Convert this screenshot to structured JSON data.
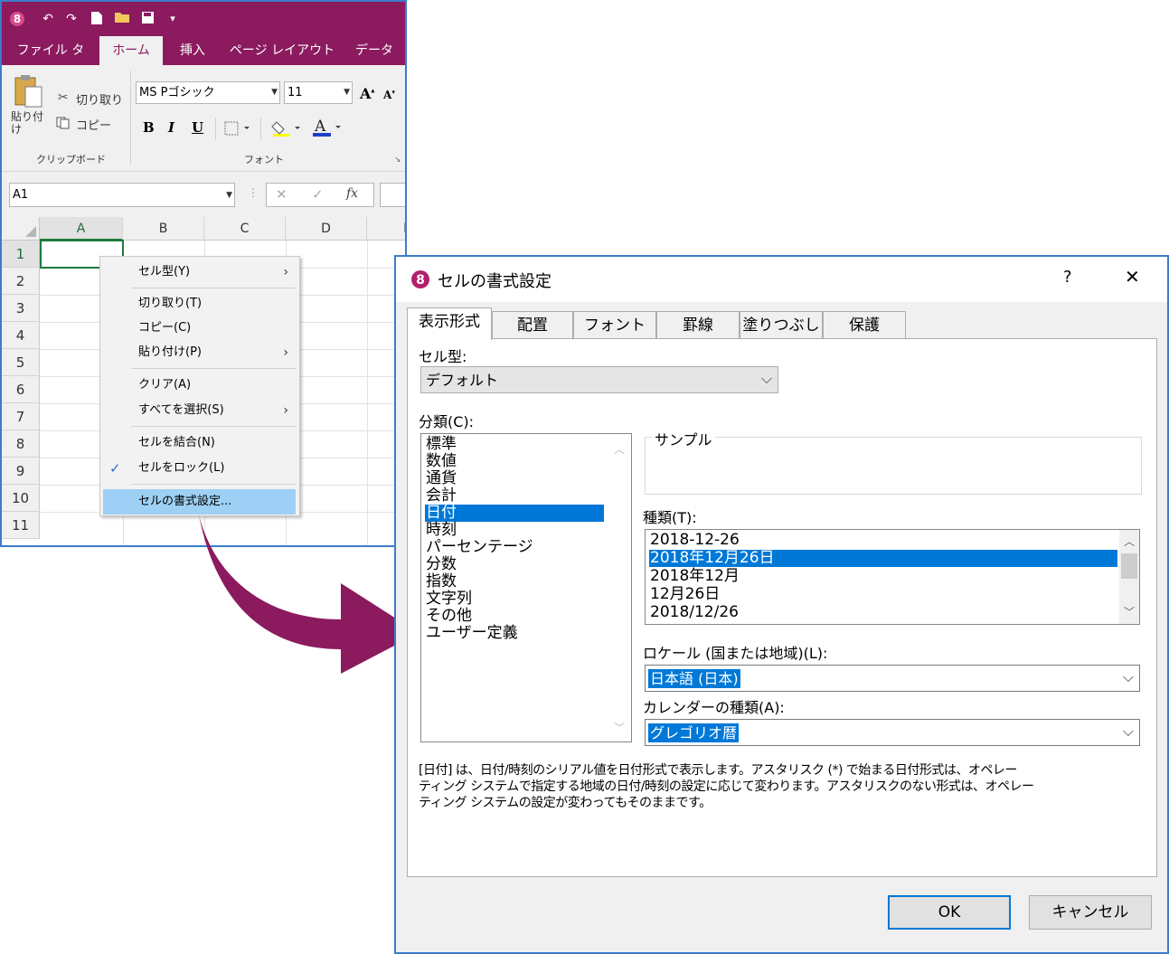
{
  "app": {
    "quick_access": [
      "↶",
      "↷",
      "🗋",
      "📂",
      "💾",
      "▾"
    ],
    "ribbon_tabs": [
      "ファイル タブ",
      "ホーム",
      "挿入",
      "ページ レイアウト",
      "データ"
    ],
    "active_tab": "ホーム",
    "clipboard": {
      "paste_label": "貼り付け",
      "cut_label": "切り取り",
      "copy_label": "コピー",
      "group_label": "クリップボード"
    },
    "font": {
      "name": "MS Pゴシック",
      "size": "11",
      "bold": "B",
      "italic": "I",
      "underline": "U",
      "group_label": "フォント"
    },
    "formula_bar": {
      "name_box": "A1",
      "cancel": "✕",
      "enter": "✓",
      "fx": "fx"
    },
    "columns": [
      "A",
      "B",
      "C",
      "D",
      "E"
    ],
    "rows": [
      "1",
      "2",
      "3",
      "4",
      "5",
      "6",
      "7",
      "8",
      "9",
      "10",
      "11"
    ]
  },
  "context_menu": {
    "items": [
      {
        "label": "セル型(Y)",
        "arrow": "›"
      },
      {
        "label": "切り取り(T)"
      },
      {
        "label": "コピー(C)"
      },
      {
        "label": "貼り付け(P)",
        "arrow": "›"
      },
      {
        "label": "クリア(A)"
      },
      {
        "label": "すべてを選択(S)",
        "arrow": "›"
      },
      {
        "label": "セルを結合(N)"
      },
      {
        "label": "セルをロック(L)",
        "check": "✓"
      },
      {
        "label": "セルの書式設定..."
      }
    ]
  },
  "dialog": {
    "title": "セルの書式設定",
    "help": "?",
    "close": "✕",
    "tabs": [
      "表示形式",
      "配置",
      "フォント",
      "罫線",
      "塗りつぶし",
      "保護"
    ],
    "active_tab": "表示形式",
    "cell_type_label": "セル型:",
    "cell_type_value": "デフォルト",
    "category_label": "分類(C):",
    "categories": [
      "標準",
      "数値",
      "通貨",
      "会計",
      "日付",
      "時刻",
      "パーセンテージ",
      "分数",
      "指数",
      "文字列",
      "その他",
      "ユーザー定義"
    ],
    "selected_category": "日付",
    "sample_label": "サンプル",
    "type_label": "種類(T):",
    "types": [
      "2018-12-26",
      "2018年12月26日",
      "2018年12月",
      "12月26日",
      "2018/12/26"
    ],
    "selected_type": "2018年12月26日",
    "locale_label": "ロケール (国または地域)(L):",
    "locale_value": "日本語 (日本)",
    "calendar_label": "カレンダーの種類(A):",
    "calendar_value": "グレゴリオ暦",
    "description_lines": [
      "[日付] は、日付/時刻のシリアル値を日付形式で表示します。アスタリスク (*) で始まる日付形式は、オペレー",
      "ティング システムで指定する地域の日付/時刻の設定に応じて変わります。アスタリスクのない形式は、オペレー",
      "ティング システムの設定が変わってもそのままです。"
    ],
    "ok_label": "OK",
    "cancel_label": "キャンセル"
  },
  "colors": {
    "brand": "#8b1a5e",
    "selection": "#0078d7",
    "window_border": "#3d7cc9",
    "arrow": "#8b1a5e"
  }
}
